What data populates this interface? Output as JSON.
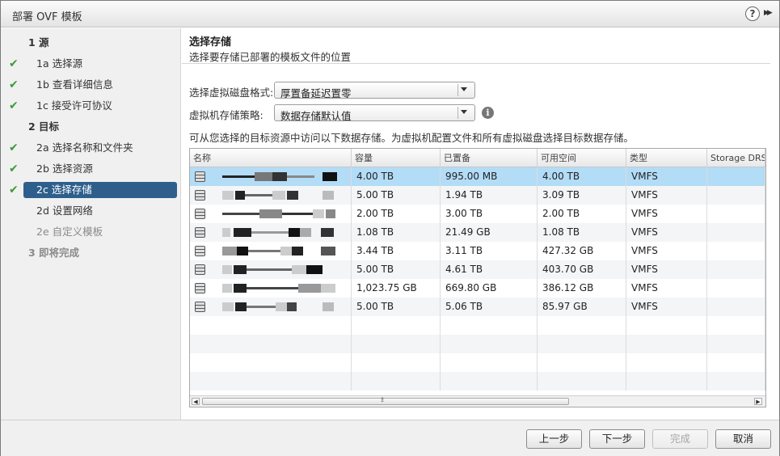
{
  "window": {
    "title": "部署 OVF 模板",
    "help_icon": "question-circle-icon",
    "expand_icon": "double-chevron-right-icon"
  },
  "sidebar": {
    "steps": [
      {
        "label": "1  源",
        "kind": "group",
        "checked": false
      },
      {
        "label": "1a  选择源",
        "kind": "item",
        "checked": true
      },
      {
        "label": "1b  查看详细信息",
        "kind": "item",
        "checked": true
      },
      {
        "label": "1c  接受许可协议",
        "kind": "item",
        "checked": true
      },
      {
        "label": "2  目标",
        "kind": "group",
        "checked": false
      },
      {
        "label": "2a  选择名称和文件夹",
        "kind": "item",
        "checked": true
      },
      {
        "label": "2b  选择资源",
        "kind": "item",
        "checked": true
      },
      {
        "label": "2c  选择存储",
        "kind": "item",
        "checked": true,
        "selected": true
      },
      {
        "label": "2d  设置网络",
        "kind": "item",
        "checked": false
      },
      {
        "label": "2e  自定义模板",
        "kind": "item",
        "checked": false,
        "disabled": true
      },
      {
        "label": "3  即将完成",
        "kind": "group",
        "checked": false,
        "disabled": true
      }
    ]
  },
  "main": {
    "title": "选择存储",
    "subtitle": "选择要存储已部署的模板文件的位置",
    "disk_format_label": "选择虚拟磁盘格式:",
    "disk_format_value": "厚置备延迟置零",
    "storage_policy_label": "虚拟机存储策略:",
    "storage_policy_value": "数据存储默认值",
    "description": "可从您选择的目标资源中访问以下数据存储。为虚拟机配置文件和所有虚拟磁盘选择目标数据存储。"
  },
  "table": {
    "columns": [
      "名称",
      "容量",
      "已置备",
      "可用空间",
      "类型",
      "Storage DRS"
    ],
    "rows": [
      {
        "name": "",
        "capacity": "4.00 TB",
        "provisioned": "995.00 MB",
        "free": "4.00 TB",
        "type": "VMFS",
        "drs": "",
        "selected": true
      },
      {
        "name": "",
        "capacity": "5.00 TB",
        "provisioned": "1.94 TB",
        "free": "3.09 TB",
        "type": "VMFS",
        "drs": ""
      },
      {
        "name": "",
        "capacity": "2.00 TB",
        "provisioned": "3.00 TB",
        "free": "2.00 TB",
        "type": "VMFS",
        "drs": ""
      },
      {
        "name": "",
        "capacity": "1.08 TB",
        "provisioned": "21.49 GB",
        "free": "1.08 TB",
        "type": "VMFS",
        "drs": ""
      },
      {
        "name": "",
        "capacity": "3.44 TB",
        "provisioned": "3.11 TB",
        "free": "427.32 GB",
        "type": "VMFS",
        "drs": ""
      },
      {
        "name": "",
        "capacity": "5.00 TB",
        "provisioned": "4.61 TB",
        "free": "403.70 GB",
        "type": "VMFS",
        "drs": ""
      },
      {
        "name": "",
        "capacity": "1,023.75 GB",
        "provisioned": "669.80 GB",
        "free": "386.12 GB",
        "type": "VMFS",
        "drs": ""
      },
      {
        "name": "",
        "capacity": "5.00 TB",
        "provisioned": "5.06 TB",
        "free": "85.97 GB",
        "type": "VMFS",
        "drs": ""
      }
    ],
    "datastore_icon": "datastore-icon",
    "selection_color": "#b3dcf7"
  },
  "footer": {
    "back": "上一步",
    "next": "下一步",
    "finish": "完成",
    "cancel": "取消"
  },
  "colors": {
    "selected_step": "#2e5f8c",
    "checkmark": "#3b9a3b"
  }
}
